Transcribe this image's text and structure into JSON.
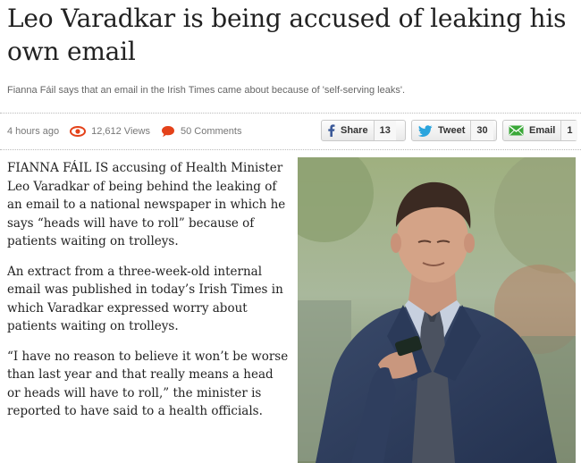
{
  "article": {
    "headline": "Leo Varadkar is being accused of leaking his own email",
    "subhead": "Fianna Fáil says that an email in the Irish Times came about because of 'self-serving leaks'.",
    "meta": {
      "time": "4 hours ago",
      "views": "12,612 Views",
      "comments": "50 Comments"
    },
    "share": {
      "facebook": {
        "label": "Share",
        "count": "13"
      },
      "twitter": {
        "label": "Tweet",
        "count": "30"
      },
      "email": {
        "label": "Email",
        "count": "1"
      }
    },
    "paragraphs": [
      "FIANNA FÁIL IS accusing of Health Minister Leo Varadkar of being behind the leaking of an email to a national newspaper in which he says “heads will have to roll” because of patients waiting on trolleys.",
      "An extract from a three-week-old internal email was published in today’s Irish Times in which Varadkar expressed worry about patients waiting on trolleys.",
      "“I have no reason to believe it won’t be worse than last year and that really means a head or heads will have to roll,” the minister is reported to have said to a health officials."
    ]
  },
  "colors": {
    "views_icon": "#e4421a",
    "comments_icon": "#e4421a",
    "facebook": "#3b5998",
    "twitter": "#2aa4dd",
    "email": "#3aa838"
  },
  "icons": [
    "eye-icon",
    "comment-bubble-icon",
    "facebook-icon",
    "twitter-bird-icon",
    "envelope-icon"
  ]
}
